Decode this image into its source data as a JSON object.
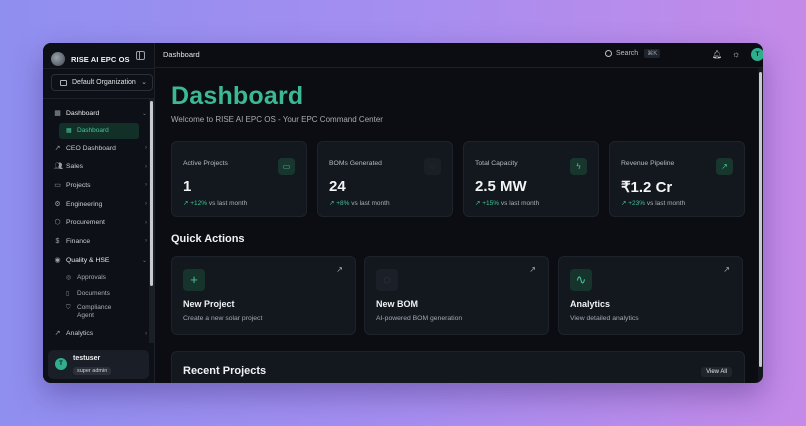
{
  "app": {
    "name": "RISE AI EPC OS"
  },
  "org_select": {
    "value": "Default Organization"
  },
  "sidebar": {
    "items": [
      {
        "label": "Dashboard",
        "icon": "grid-icon",
        "open": true
      },
      {
        "label": "Dashboard",
        "icon": "grid-icon",
        "sub": true,
        "active": true
      },
      {
        "label": "CEO Dashboard",
        "icon": "trend-up-icon"
      },
      {
        "label": "Sales",
        "icon": "users-icon"
      },
      {
        "label": "Projects",
        "icon": "folder-icon"
      },
      {
        "label": "Engineering",
        "icon": "gear-icon"
      },
      {
        "label": "Procurement",
        "icon": "package-icon"
      },
      {
        "label": "Finance",
        "icon": "dollar-icon"
      },
      {
        "label": "Quality & HSE",
        "icon": "check-circle-icon",
        "open": true
      },
      {
        "label": "Approvals",
        "icon": "check-circle-icon",
        "sub": true
      },
      {
        "label": "Documents",
        "icon": "file-icon",
        "sub": true
      },
      {
        "label": "Compliance Agent",
        "icon": "shield-icon",
        "sub": true
      },
      {
        "label": "Analytics",
        "icon": "trend-up-icon"
      }
    ],
    "user": {
      "initial": "T",
      "name": "testuser",
      "role": "super admin"
    }
  },
  "topbar": {
    "breadcrumb": "Dashboard",
    "search_label": "Search",
    "search_shortcut": "⌘K",
    "user_initial": "T",
    "user_name": "testuser"
  },
  "main": {
    "title": "Dashboard",
    "subtitle": "Welcome to RISE AI EPC OS - Your EPC Command Center",
    "stats": [
      {
        "label": "Active Projects",
        "value": "1",
        "delta": "+12%",
        "delta_suffix": "vs last month",
        "icon": "folder-icon"
      },
      {
        "label": "BOMs Generated",
        "value": "24",
        "delta": "+8%",
        "delta_suffix": "vs last month",
        "icon": "cpu-icon"
      },
      {
        "label": "Total Capacity",
        "value": "2.5 MW",
        "delta": "+15%",
        "delta_suffix": "vs last month",
        "icon": "bolt-icon"
      },
      {
        "label": "Revenue Pipeline",
        "value": "₹1.2 Cr",
        "delta": "+23%",
        "delta_suffix": "vs last month",
        "icon": "trend-up-icon"
      }
    ],
    "quick_actions_title": "Quick Actions",
    "quick_actions": [
      {
        "title": "New Project",
        "desc": "Create a new solar project",
        "icon": "plus-icon"
      },
      {
        "title": "New BOM",
        "desc": "AI-powered BOM generation",
        "icon": "cpu-icon"
      },
      {
        "title": "Analytics",
        "desc": "View detailed analytics",
        "icon": "pulse-icon"
      }
    ],
    "recent_projects_title": "Recent Projects",
    "view_all_label": "View All"
  },
  "colors": {
    "accent": "#3bb894",
    "background": "#0b0d12",
    "card": "#13171e"
  }
}
